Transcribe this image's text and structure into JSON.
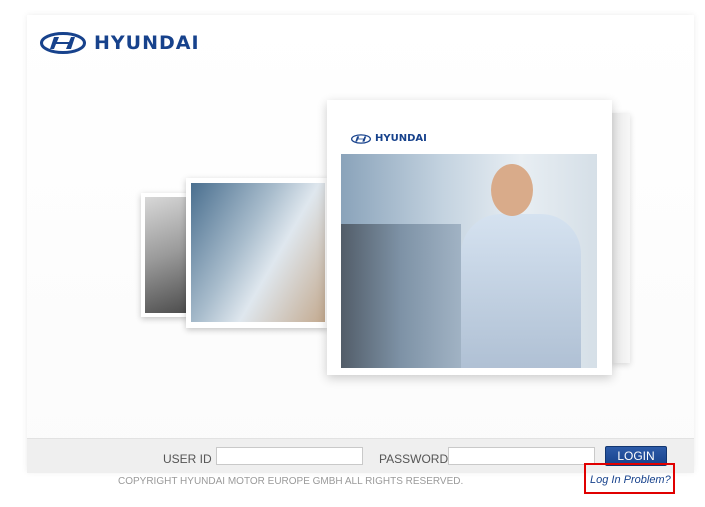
{
  "brand": {
    "name": "HYUNDAI",
    "color": "#17428c",
    "logo_icon": "hyundai-logo-icon"
  },
  "showcase": {
    "book_brand": "HYUNDAI"
  },
  "login": {
    "userid_label": "USER ID",
    "userid_value": "",
    "password_label": "PASSWORD",
    "password_value": "",
    "button_label": "LOGIN"
  },
  "footer": {
    "copyright": "COPYRIGHT HYUNDAI MOTOR EUROPE GMBH ALL RIGHTS RESERVED.",
    "problem_link": "Log In Problem?",
    "highlight_color": "#e00000"
  }
}
